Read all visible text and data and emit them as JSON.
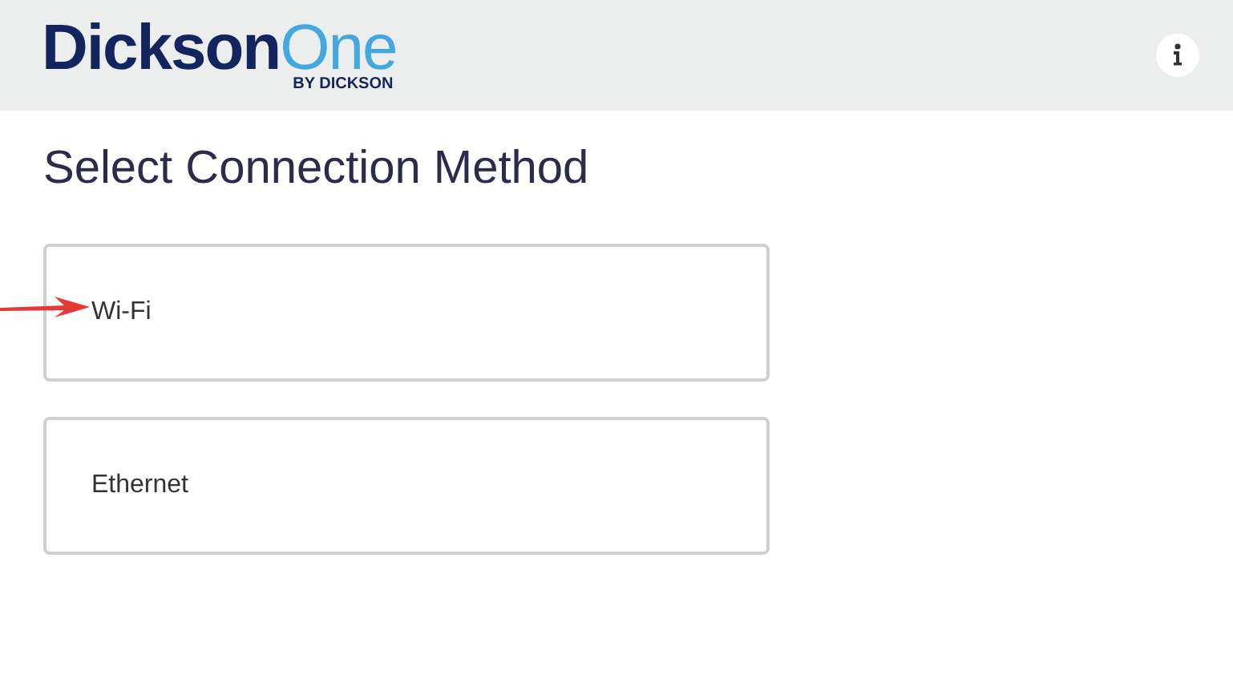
{
  "header": {
    "logo": {
      "brand": "Dickson",
      "suffix": "One",
      "tagline": "BY DICKSON"
    }
  },
  "title": "Select Connection Method",
  "options": [
    {
      "label": "Wi-Fi",
      "annotated": true
    },
    {
      "label": "Ethernet",
      "annotated": false
    }
  ]
}
